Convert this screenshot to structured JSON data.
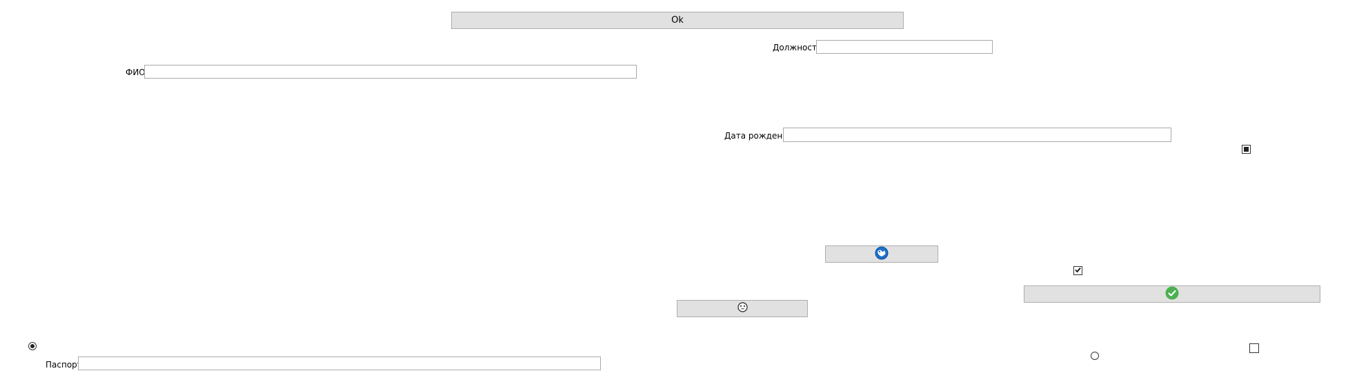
{
  "buttons": {
    "ok_label": "Ok"
  },
  "fields": {
    "position": {
      "label": "Должность",
      "value": ""
    },
    "full_name": {
      "label": "ФИО",
      "value": ""
    },
    "birth_date": {
      "label": "Дата рождения",
      "value": ""
    },
    "passport": {
      "label": "Паспорт",
      "value": ""
    }
  },
  "icons": {
    "refresh_button_icon": "blue-globe-icon",
    "confirm_button_icon": "green-check-circle-icon",
    "smiley_button_icon": "smiley-face-icon"
  },
  "controls": {
    "checkbox_indeterminate": "indeterminate",
    "checkbox_checked": "checked",
    "checkbox_unchecked": "unchecked",
    "radio_selected": "selected",
    "radio_unselected": "unselected"
  },
  "colors": {
    "button_bg": "#e1e1e1",
    "button_border": "#adadad",
    "input_border": "#a9a9a9",
    "globe_blue": "#1e6fc8",
    "check_green": "#4caf50"
  }
}
